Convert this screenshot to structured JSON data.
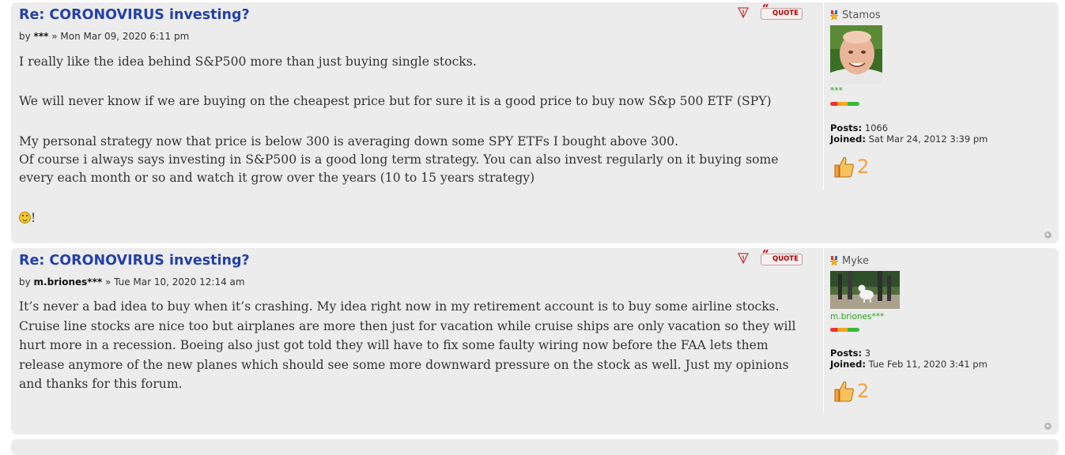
{
  "posts": [
    {
      "title": "Re: CORONOVIRUS investing?",
      "by_prefix": "by",
      "author": "***",
      "date_sep": "»",
      "date": "Mon Mar 09, 2020 6:11 pm",
      "paragraphs": [
        "I really like the idea behind S&P500 more than just buying single stocks.",
        "We will never know if we are buying on the cheapest price but for sure it is a good price to buy now S&p 500 ETF (SPY)",
        "My personal strategy now that price is below 300 is averaging down some SPY ETFs I bought above 300.",
        "Of course i always says investing in S&P500 is a good long term strategy. You can also invest regularly on it buying some",
        "every each month or so and watch it grow over the years (10 to 15 years strategy)"
      ],
      "trailing_text": "!",
      "quote_label": "QUOTE",
      "profile": {
        "username": "Stamos",
        "rank_title": "***",
        "posts_label": "Posts:",
        "posts": "1066",
        "joined_label": "Joined:",
        "joined": "Sat Mar 24, 2012 3:39 pm",
        "likes": "2"
      }
    },
    {
      "title": "Re: CORONOVIRUS investing?",
      "by_prefix": "by",
      "author": "m.briones***",
      "date_sep": "»",
      "date": "Tue Mar 10, 2020 12:14 am",
      "body": "It’s never a bad idea to buy when it’s crashing. My idea right now in my retirement account is to buy some airline stocks. Cruise line stocks are nice too but airplanes are more then just for vacation while cruise ships are only vacation so they will hurt more in a recession. Boeing also just got told they will have to fix some faulty wiring now before the FAA lets them release anymore of the new planes which should see some more downward pressure on the stock as well. Just my opinions and thanks for this forum.",
      "quote_label": "QUOTE",
      "profile": {
        "username": "Myke",
        "rank_title": "m.briones***",
        "posts_label": "Posts:",
        "posts": "3",
        "joined_label": "Joined:",
        "joined": "Tue Feb 11, 2020 3:41 pm",
        "likes": "2"
      }
    }
  ],
  "colors": {
    "title": "#2540a8",
    "post_bg": "#ececec",
    "rank_title": "#2aa01e",
    "likes": "#f2a13c",
    "quote": "#b00000"
  },
  "icons": [
    "report-icon",
    "quote-icon",
    "rank-star-icon",
    "thumbs-up-icon",
    "back-to-top-icon",
    "smiley-icon"
  ]
}
